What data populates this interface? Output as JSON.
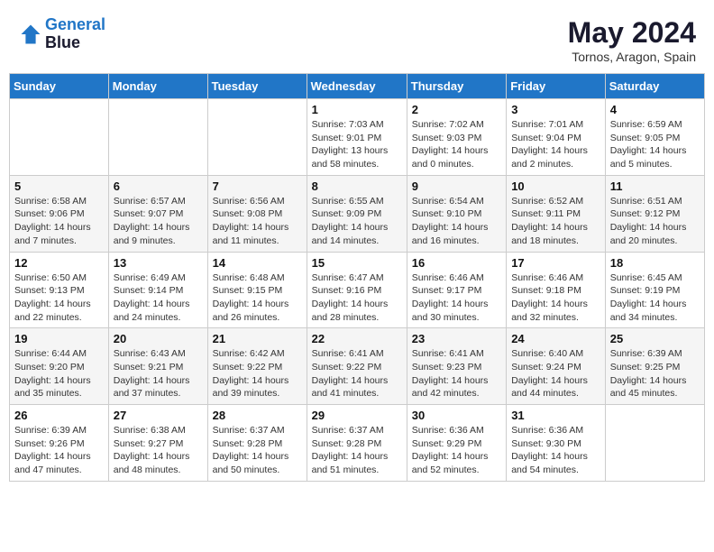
{
  "logo": {
    "line1": "General",
    "line2": "Blue"
  },
  "title": "May 2024",
  "location": "Tornos, Aragon, Spain",
  "weekdays": [
    "Sunday",
    "Monday",
    "Tuesday",
    "Wednesday",
    "Thursday",
    "Friday",
    "Saturday"
  ],
  "weeks": [
    [
      null,
      null,
      null,
      {
        "day": "1",
        "sunrise": "7:03 AM",
        "sunset": "9:01 PM",
        "daylight": "13 hours and 58 minutes."
      },
      {
        "day": "2",
        "sunrise": "7:02 AM",
        "sunset": "9:03 PM",
        "daylight": "14 hours and 0 minutes."
      },
      {
        "day": "3",
        "sunrise": "7:01 AM",
        "sunset": "9:04 PM",
        "daylight": "14 hours and 2 minutes."
      },
      {
        "day": "4",
        "sunrise": "6:59 AM",
        "sunset": "9:05 PM",
        "daylight": "14 hours and 5 minutes."
      }
    ],
    [
      {
        "day": "5",
        "sunrise": "6:58 AM",
        "sunset": "9:06 PM",
        "daylight": "14 hours and 7 minutes."
      },
      {
        "day": "6",
        "sunrise": "6:57 AM",
        "sunset": "9:07 PM",
        "daylight": "14 hours and 9 minutes."
      },
      {
        "day": "7",
        "sunrise": "6:56 AM",
        "sunset": "9:08 PM",
        "daylight": "14 hours and 11 minutes."
      },
      {
        "day": "8",
        "sunrise": "6:55 AM",
        "sunset": "9:09 PM",
        "daylight": "14 hours and 14 minutes."
      },
      {
        "day": "9",
        "sunrise": "6:54 AM",
        "sunset": "9:10 PM",
        "daylight": "14 hours and 16 minutes."
      },
      {
        "day": "10",
        "sunrise": "6:52 AM",
        "sunset": "9:11 PM",
        "daylight": "14 hours and 18 minutes."
      },
      {
        "day": "11",
        "sunrise": "6:51 AM",
        "sunset": "9:12 PM",
        "daylight": "14 hours and 20 minutes."
      }
    ],
    [
      {
        "day": "12",
        "sunrise": "6:50 AM",
        "sunset": "9:13 PM",
        "daylight": "14 hours and 22 minutes."
      },
      {
        "day": "13",
        "sunrise": "6:49 AM",
        "sunset": "9:14 PM",
        "daylight": "14 hours and 24 minutes."
      },
      {
        "day": "14",
        "sunrise": "6:48 AM",
        "sunset": "9:15 PM",
        "daylight": "14 hours and 26 minutes."
      },
      {
        "day": "15",
        "sunrise": "6:47 AM",
        "sunset": "9:16 PM",
        "daylight": "14 hours and 28 minutes."
      },
      {
        "day": "16",
        "sunrise": "6:46 AM",
        "sunset": "9:17 PM",
        "daylight": "14 hours and 30 minutes."
      },
      {
        "day": "17",
        "sunrise": "6:46 AM",
        "sunset": "9:18 PM",
        "daylight": "14 hours and 32 minutes."
      },
      {
        "day": "18",
        "sunrise": "6:45 AM",
        "sunset": "9:19 PM",
        "daylight": "14 hours and 34 minutes."
      }
    ],
    [
      {
        "day": "19",
        "sunrise": "6:44 AM",
        "sunset": "9:20 PM",
        "daylight": "14 hours and 35 minutes."
      },
      {
        "day": "20",
        "sunrise": "6:43 AM",
        "sunset": "9:21 PM",
        "daylight": "14 hours and 37 minutes."
      },
      {
        "day": "21",
        "sunrise": "6:42 AM",
        "sunset": "9:22 PM",
        "daylight": "14 hours and 39 minutes."
      },
      {
        "day": "22",
        "sunrise": "6:41 AM",
        "sunset": "9:22 PM",
        "daylight": "14 hours and 41 minutes."
      },
      {
        "day": "23",
        "sunrise": "6:41 AM",
        "sunset": "9:23 PM",
        "daylight": "14 hours and 42 minutes."
      },
      {
        "day": "24",
        "sunrise": "6:40 AM",
        "sunset": "9:24 PM",
        "daylight": "14 hours and 44 minutes."
      },
      {
        "day": "25",
        "sunrise": "6:39 AM",
        "sunset": "9:25 PM",
        "daylight": "14 hours and 45 minutes."
      }
    ],
    [
      {
        "day": "26",
        "sunrise": "6:39 AM",
        "sunset": "9:26 PM",
        "daylight": "14 hours and 47 minutes."
      },
      {
        "day": "27",
        "sunrise": "6:38 AM",
        "sunset": "9:27 PM",
        "daylight": "14 hours and 48 minutes."
      },
      {
        "day": "28",
        "sunrise": "6:37 AM",
        "sunset": "9:28 PM",
        "daylight": "14 hours and 50 minutes."
      },
      {
        "day": "29",
        "sunrise": "6:37 AM",
        "sunset": "9:28 PM",
        "daylight": "14 hours and 51 minutes."
      },
      {
        "day": "30",
        "sunrise": "6:36 AM",
        "sunset": "9:29 PM",
        "daylight": "14 hours and 52 minutes."
      },
      {
        "day": "31",
        "sunrise": "6:36 AM",
        "sunset": "9:30 PM",
        "daylight": "14 hours and 54 minutes."
      },
      null
    ]
  ]
}
